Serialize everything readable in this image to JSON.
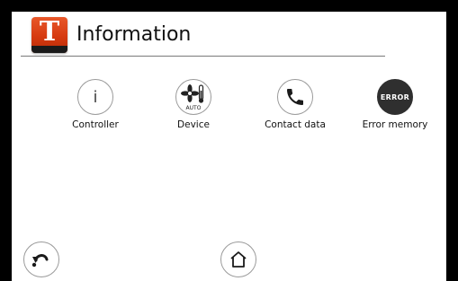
{
  "header": {
    "title": "Information",
    "logo_letter": "T"
  },
  "tiles": [
    {
      "label": "Controller",
      "icon": "info-icon"
    },
    {
      "label": "Device",
      "icon": "fan-thermometer-icon",
      "icon_text": "AUTO"
    },
    {
      "label": "Contact data",
      "icon": "phone-icon"
    },
    {
      "label": "Error memory",
      "icon": "error-icon",
      "icon_text": "ERROR"
    }
  ],
  "footer": {
    "back_icon": "back-arrow-icon",
    "home_icon": "home-icon"
  },
  "colors": {
    "accent": "#d63a10",
    "circle_border": "#9a9a9a",
    "error_bg": "#2f2f2f"
  }
}
